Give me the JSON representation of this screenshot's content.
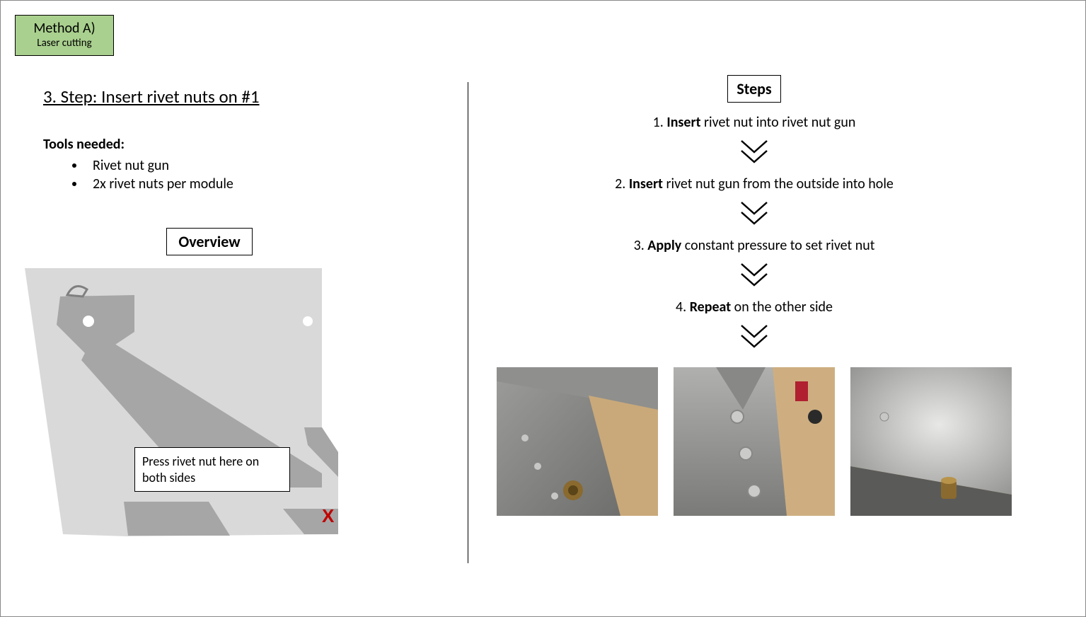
{
  "method": {
    "title": "Method A)",
    "subtitle": "Laser cutting"
  },
  "left": {
    "step_title": "3. Step: Insert rivet nuts on #1",
    "tools_label": "Tools needed:",
    "tools": [
      "Rivet nut gun",
      "2x rivet nuts per module"
    ],
    "overview_label": "Overview",
    "callout": "Press rivet nut here on both sides",
    "x_mark": "X"
  },
  "right": {
    "steps_label": "Steps",
    "steps": [
      {
        "n": "1.",
        "b": "Insert",
        "rest": " rivet nut into rivet nut gun"
      },
      {
        "n": "2.",
        "b": "Insert",
        "rest": " rivet nut gun from the outside into hole"
      },
      {
        "n": "3.",
        "b": "Apply",
        "rest": " constant pressure to set rivet nut"
      },
      {
        "n": "4.",
        "b": "Repeat",
        "rest": " on the other side"
      }
    ]
  }
}
